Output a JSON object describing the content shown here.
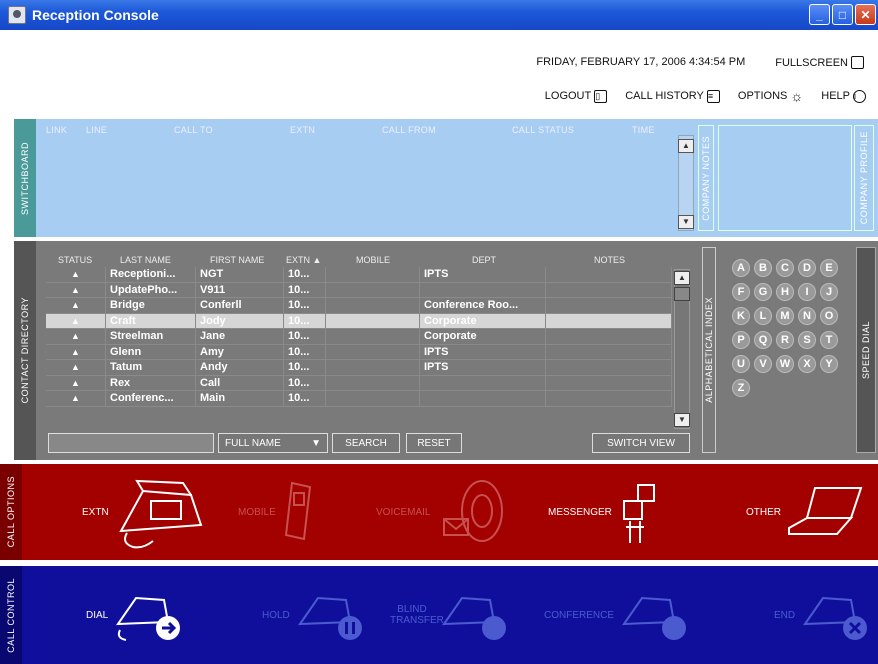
{
  "window": {
    "title": "Reception Console",
    "controls": [
      "minimize",
      "maximize",
      "close"
    ]
  },
  "header": {
    "datetime": "FRIDAY, FEBRUARY 17, 2006 4:34:54 PM",
    "fullscreen": "FULLSCREEN",
    "links": {
      "logout": "LOGOUT",
      "history": "CALL HISTORY",
      "options": "OPTIONS",
      "help": "HELP"
    }
  },
  "switchboard": {
    "tab": "SWITCHBOARD",
    "columns": [
      "LINK",
      "LINE",
      "CALL TO",
      "EXTN",
      "CALL FROM",
      "CALL STATUS",
      "TIME"
    ],
    "notes": "COMPANY NOTES",
    "profile": "COMPANY PROFILE"
  },
  "directory": {
    "tab": "CONTACT DIRECTORY",
    "columns": [
      "STATUS",
      "LAST NAME",
      "FIRST NAME",
      "EXTN ▲",
      "MOBILE",
      "DEPT",
      "NOTES"
    ],
    "rows": [
      [
        "▲",
        "Receptioni...",
        "NGT",
        "10...",
        "",
        "IPTS",
        ""
      ],
      [
        "▲",
        "UpdatePho...",
        "V911",
        "10...",
        "",
        "",
        ""
      ],
      [
        "▲",
        "Bridge",
        "Conferll",
        "10...",
        "",
        "Conference Roo...",
        ""
      ],
      [
        "▲",
        "Craft",
        "Jody",
        "10...",
        "",
        "Corporate",
        ""
      ],
      [
        "▲",
        "Streelman",
        "Jane",
        "10...",
        "",
        "Corporate",
        ""
      ],
      [
        "▲",
        "Glenn",
        "Amy",
        "10...",
        "",
        "IPTS",
        ""
      ],
      [
        "▲",
        "Tatum",
        "Andy",
        "10...",
        "",
        "IPTS",
        ""
      ],
      [
        "▲",
        "Rex",
        "Call",
        "10...",
        "",
        "",
        ""
      ],
      [
        "▲",
        "Conferenc...",
        "Main",
        "10...",
        "",
        "",
        ""
      ]
    ],
    "selected_row": 3,
    "search_mode": "FULL NAME",
    "search_button": "SEARCH",
    "reset_button": "RESET",
    "switch_button": "SWITCH VIEW",
    "alpha_label": "ALPHABETICAL INDEX",
    "letters": [
      "A",
      "B",
      "C",
      "D",
      "E",
      "F",
      "G",
      "H",
      "I",
      "J",
      "K",
      "L",
      "M",
      "N",
      "O",
      "P",
      "Q",
      "R",
      "S",
      "T",
      "U",
      "V",
      "W",
      "X",
      "Y",
      "Z"
    ],
    "speed_dial": "SPEED DIAL"
  },
  "call_options": {
    "tab": "CALL OPTIONS",
    "items": [
      {
        "label": "EXTN",
        "active": true
      },
      {
        "label": "MOBILE",
        "active": false
      },
      {
        "label": "VOICEMAIL",
        "active": false
      },
      {
        "label": "MESSENGER",
        "active": true
      },
      {
        "label": "OTHER",
        "active": true
      }
    ]
  },
  "call_control": {
    "tab": "CALL CONTROL",
    "items": [
      {
        "label": "DIAL",
        "active": true
      },
      {
        "label": "HOLD",
        "active": false
      },
      {
        "label": "BLIND TRANSFER",
        "active": false
      },
      {
        "label": "CONFERENCE",
        "active": false
      },
      {
        "label": "END",
        "active": false
      }
    ]
  }
}
